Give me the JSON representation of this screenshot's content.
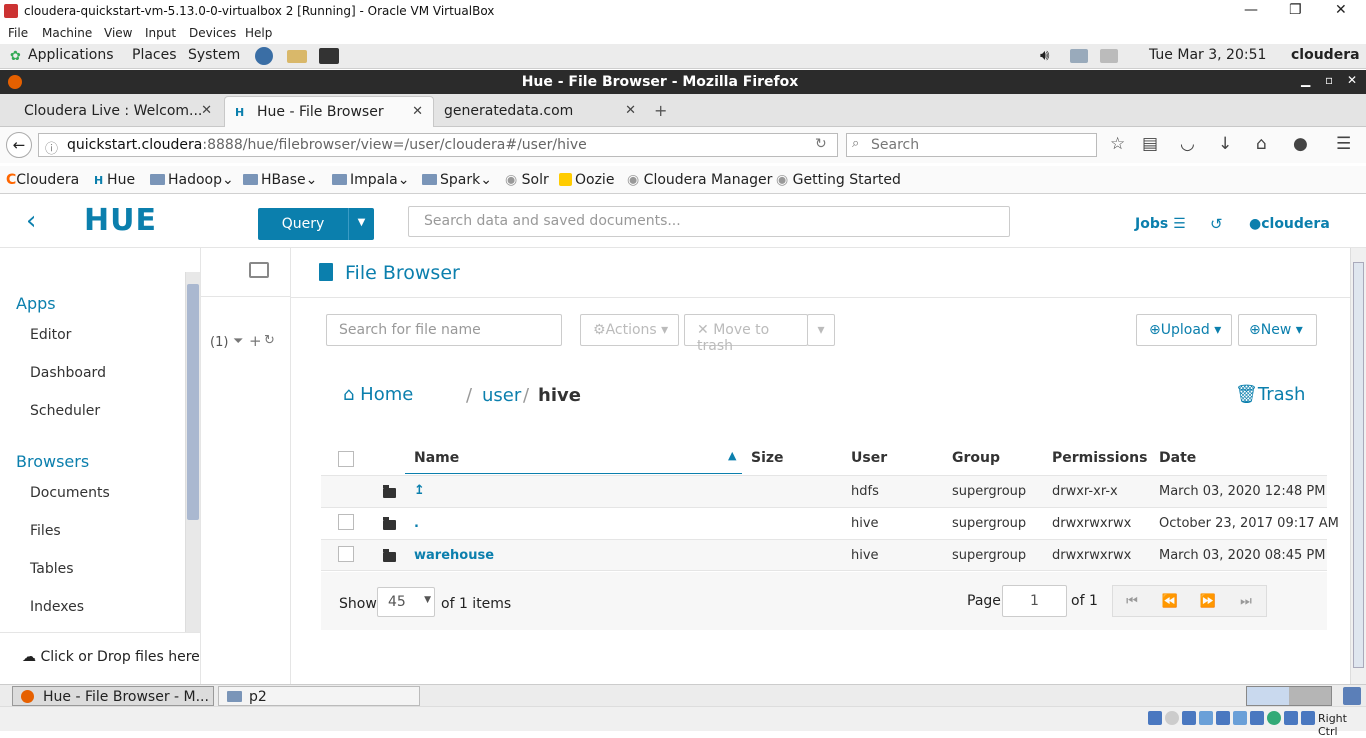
{
  "vbox": {
    "title": "cloudera-quickstart-vm-5.13.0-0-virtualbox 2 [Running] - Oracle VM VirtualBox",
    "menu": [
      "File",
      "Machine",
      "View",
      "Input",
      "Devices",
      "Help"
    ],
    "host_key": "Right Ctrl"
  },
  "gnome": {
    "menu": [
      "Applications",
      "Places",
      "System"
    ],
    "clock": "Tue Mar  3, 20:51",
    "user": "cloudera"
  },
  "firefox": {
    "title": "Hue - File Browser - Mozilla Firefox",
    "tabs": [
      {
        "label": "Cloudera Live : Welcom..."
      },
      {
        "label": "Hue - File Browser"
      },
      {
        "label": "generatedata.com"
      }
    ],
    "url_host": "quickstart.cloudera",
    "url_rest": ":8888/hue/filebrowser/view=/user/cloudera#/user/hive",
    "search_placeholder": "Search",
    "bookmarks": [
      "Cloudera",
      "Hue",
      "Hadoop",
      "HBase",
      "Impala",
      "Spark",
      "Solr",
      "Oozie",
      "Cloudera Manager",
      "Getting Started"
    ]
  },
  "hue": {
    "logo": "HUE",
    "query_label": "Query",
    "search_placeholder": "Search data and saved documents...",
    "jobs_label": "Jobs",
    "user": "cloudera"
  },
  "sidebar": {
    "apps_title": "Apps",
    "apps": [
      "Editor",
      "Dashboard",
      "Scheduler"
    ],
    "browsers_title": "Browsers",
    "browsers": [
      "Documents",
      "Files",
      "Tables",
      "Indexes"
    ],
    "drop_label": "Click or Drop files here"
  },
  "assist": {
    "count": "(1)"
  },
  "filebrowser": {
    "title": "File Browser",
    "filter_placeholder": "Search for file name",
    "actions_label": "Actions",
    "trash_move_label": "Move to trash",
    "upload_label": "Upload",
    "new_label": "New",
    "home_label": "Home",
    "crumbs": [
      "user",
      "hive"
    ],
    "trash_label": "Trash",
    "columns": [
      "Name",
      "Size",
      "User",
      "Group",
      "Permissions",
      "Date"
    ],
    "rows": [
      {
        "name": "↥",
        "size": "",
        "user": "hdfs",
        "group": "supergroup",
        "perm": "drwxr-xr-x",
        "date": "March 03, 2020 12:48 PM"
      },
      {
        "name": ".",
        "size": "",
        "user": "hive",
        "group": "supergroup",
        "perm": "drwxrwxrwx",
        "date": "October 23, 2017 09:17 AM"
      },
      {
        "name": "warehouse",
        "size": "",
        "user": "hive",
        "group": "supergroup",
        "perm": "drwxrwxrwx",
        "date": "March 03, 2020 08:45 PM"
      }
    ],
    "show_label": "Show",
    "page_size": "45",
    "of_items": "of 1 items",
    "page_label": "Page",
    "page": "1",
    "of_pages": "of 1"
  },
  "taskbar": {
    "items": [
      "Hue - File Browser - M...",
      "p2"
    ]
  }
}
